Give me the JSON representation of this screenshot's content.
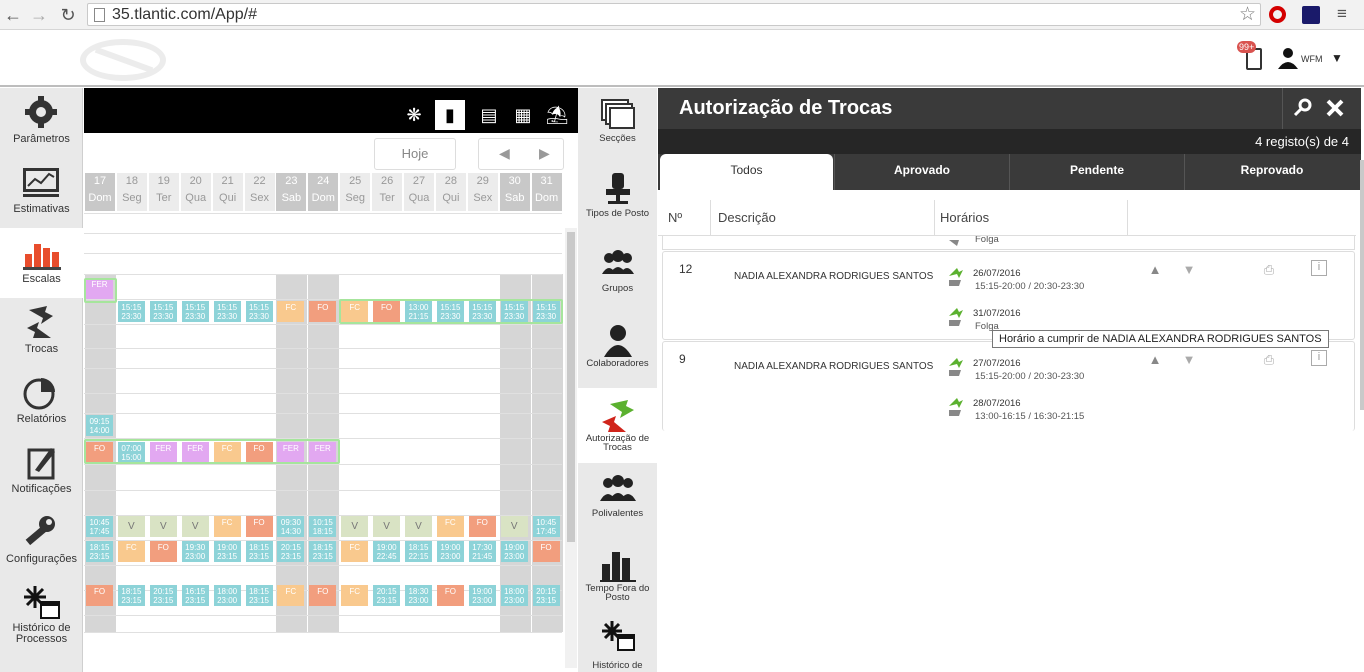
{
  "browser": {
    "url": "35.tlantic.com/App/#"
  },
  "header": {
    "badge": "99+",
    "user": "WFM"
  },
  "leftnav": [
    {
      "label": "Parâmetros",
      "icon": "gear-icon"
    },
    {
      "label": "Estimativas",
      "icon": "chart-icon"
    },
    {
      "label": "Escalas",
      "icon": "bars-icon"
    },
    {
      "label": "Trocas",
      "icon": "swap-icon"
    },
    {
      "label": "Relatórios",
      "icon": "pie-icon"
    },
    {
      "label": "Notificações",
      "icon": "notification-icon"
    },
    {
      "label": "Configurações",
      "icon": "wrench-icon"
    },
    {
      "label": "Histórico de Processos",
      "icon": "history-icon"
    }
  ],
  "schedule": {
    "today_label": "Hoje",
    "days": [
      {
        "n": "17",
        "d": "Dom",
        "we": true
      },
      {
        "n": "18",
        "d": "Seg",
        "we": false
      },
      {
        "n": "19",
        "d": "Ter",
        "we": false
      },
      {
        "n": "20",
        "d": "Qua",
        "we": false
      },
      {
        "n": "21",
        "d": "Qui",
        "we": false
      },
      {
        "n": "22",
        "d": "Sex",
        "we": false
      },
      {
        "n": "23",
        "d": "Sab",
        "we": true
      },
      {
        "n": "24",
        "d": "Dom",
        "we": true
      },
      {
        "n": "25",
        "d": "Seg",
        "we": false
      },
      {
        "n": "26",
        "d": "Ter",
        "we": false
      },
      {
        "n": "27",
        "d": "Qua",
        "we": false
      },
      {
        "n": "28",
        "d": "Qui",
        "we": false
      },
      {
        "n": "29",
        "d": "Sex",
        "we": false
      },
      {
        "n": "30",
        "d": "Sab",
        "we": true
      },
      {
        "n": "31",
        "d": "Dom",
        "we": true
      }
    ],
    "rows": [
      {
        "cells": [
          [
            "FER",
            "fer"
          ]
        ]
      },
      {
        "cells": [
          [
            "",
            ""
          ],
          [
            "15:15\n23:30",
            "time"
          ],
          [
            "15:15\n23:30",
            "time"
          ],
          [
            "15:15\n23:30",
            "time"
          ],
          [
            "15:15\n23:30",
            "time"
          ],
          [
            "15:15\n23:30",
            "time"
          ],
          [
            "FC",
            "fc"
          ],
          [
            "FO",
            "fo"
          ],
          [
            "FC",
            "fc"
          ],
          [
            "FO",
            "fo"
          ],
          [
            "13:00\n21:15",
            "time"
          ],
          [
            "15:15\n23:30",
            "time"
          ],
          [
            "15:15\n23:30",
            "time"
          ],
          [
            "15:15\n23:30",
            "time"
          ],
          [
            "15:15\n23:30",
            "time"
          ]
        ]
      },
      {
        "cells": [
          [
            "09:15\n14:00",
            "time"
          ]
        ]
      },
      {
        "cells": [
          [
            "FO",
            "fo"
          ],
          [
            "07:00\n15:00",
            "time"
          ],
          [
            "FER",
            "fer"
          ],
          [
            "FER",
            "fer"
          ],
          [
            "FC",
            "fc"
          ],
          [
            "FO",
            "fo"
          ],
          [
            "FER",
            "fer"
          ],
          [
            "FER",
            "fer"
          ]
        ]
      },
      {
        "cells": [
          [
            "10:45\n17:45",
            "time"
          ],
          [
            "V",
            "v"
          ],
          [
            "V",
            "v"
          ],
          [
            "V",
            "v"
          ],
          [
            "FC",
            "fc"
          ],
          [
            "FO",
            "fo"
          ],
          [
            "09:30\n14:30",
            "time"
          ],
          [
            "10:15\n18:15",
            "time"
          ],
          [
            "V",
            "v"
          ],
          [
            "V",
            "v"
          ],
          [
            "V",
            "v"
          ],
          [
            "FC",
            "fc"
          ],
          [
            "FO",
            "fo"
          ],
          [
            "V",
            "v"
          ],
          [
            "10:45\n17:45",
            "time"
          ]
        ]
      },
      {
        "cells": [
          [
            "18:15\n23:15",
            "time"
          ],
          [
            "FC",
            "fc"
          ],
          [
            "FO",
            "fo"
          ],
          [
            "19:30\n23:00",
            "time"
          ],
          [
            "19:00\n23:15",
            "time"
          ],
          [
            "18:15\n23:15",
            "time"
          ],
          [
            "20:15\n23:15",
            "time"
          ],
          [
            "18:15\n23:15",
            "time"
          ],
          [
            "FC",
            "fc"
          ],
          [
            "19:00\n22:45",
            "time"
          ],
          [
            "18:15\n22:15",
            "time"
          ],
          [
            "19:00\n23:00",
            "time"
          ],
          [
            "17:30\n21:45",
            "time"
          ],
          [
            "19:00\n23:00",
            "time"
          ],
          [
            "FO",
            "fo"
          ]
        ]
      },
      {
        "cells": [
          [
            "FO",
            "fo"
          ],
          [
            "18:15\n23:15",
            "time"
          ],
          [
            "20:15\n23:15",
            "time"
          ],
          [
            "16:15\n23:15",
            "time"
          ],
          [
            "18:00\n23:00",
            "time"
          ],
          [
            "18:15\n23:15",
            "time"
          ],
          [
            "FC",
            "fc"
          ],
          [
            "FO",
            "fo"
          ],
          [
            "FC",
            "fc"
          ],
          [
            "20:15\n23:15",
            "time"
          ],
          [
            "18:30\n23:00",
            "time"
          ],
          [
            "FO",
            "fo"
          ],
          [
            "19:00\n23:00",
            "time"
          ],
          [
            "18:00\n23:00",
            "time"
          ],
          [
            "20:15\n23:15",
            "time"
          ]
        ]
      }
    ]
  },
  "catnav": [
    {
      "label": "Secções"
    },
    {
      "label": "Tipos de Posto"
    },
    {
      "label": "Grupos"
    },
    {
      "label": "Colaboradores"
    },
    {
      "label": "Autorização de Trocas"
    },
    {
      "label": "Polivalentes"
    },
    {
      "label": "Tempo Fora do Posto"
    },
    {
      "label": "Histórico de"
    }
  ],
  "panel": {
    "title": "Autorização de Trocas",
    "count": "4  registo(s) de  4",
    "tabs": [
      "Todos",
      "Aprovado",
      "Pendente",
      "Reprovado"
    ],
    "columns": {
      "num": "Nº",
      "desc": "Descrição",
      "hours": "Horários"
    },
    "partial_row_text": "Folga",
    "records": [
      {
        "num": "12",
        "name": "NADIA ALEXANDRA RODRIGUES SANTOS",
        "entries": [
          {
            "date": "26/07/2016",
            "hours": "15:15-20:00 / 20:30-23:30"
          },
          {
            "date": "31/07/2016",
            "hours": "Folga"
          }
        ]
      },
      {
        "num": "9",
        "name": "NADIA ALEXANDRA RODRIGUES SANTOS",
        "entries": [
          {
            "date": "27/07/2016",
            "hours": "15:15-20:00 / 20:30-23:30"
          },
          {
            "date": "28/07/2016",
            "hours": "13:00-16:15 / 16:30-21:15"
          }
        ]
      }
    ],
    "tooltip": "Horário a cumprir de NADIA ALEXANDRA RODRIGUES SANTOS"
  }
}
